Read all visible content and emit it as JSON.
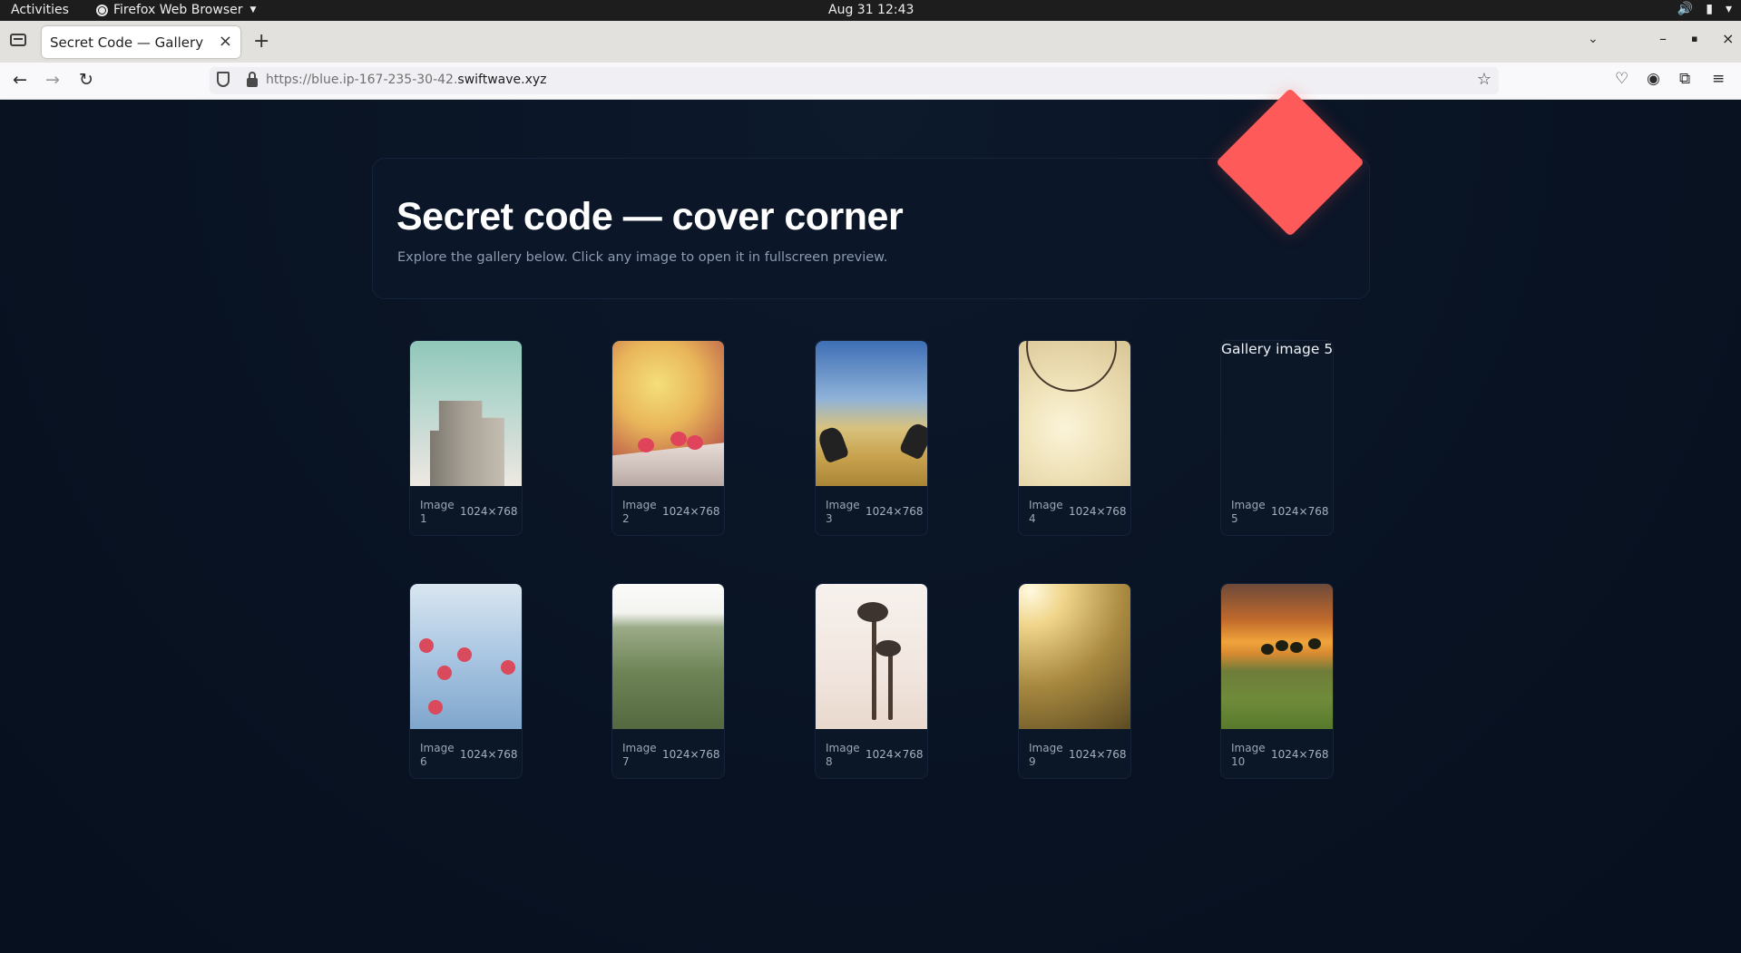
{
  "topbar": {
    "activities": "Activities",
    "app_name": "Firefox Web Browser",
    "clock": "Aug 31  12:43"
  },
  "browser": {
    "tab_title": "Secret Code — Gallery",
    "url_prefix": "https://blue.ip-167-235-30-42.",
    "url_domain": "swiftwave.xyz"
  },
  "page": {
    "title": "Secret code — cover corner",
    "subtitle": "Explore the gallery below. Click any image to open it in fullscreen preview.",
    "accent_color": "#ff5a5a"
  },
  "gallery": [
    {
      "caption": "Image 1",
      "dims": "1024×768"
    },
    {
      "caption": "Image 2",
      "dims": "1024×768"
    },
    {
      "caption": "Image 3",
      "dims": "1024×768"
    },
    {
      "caption": "Image 4",
      "dims": "1024×768"
    },
    {
      "caption": "Image 5",
      "dims": "1024×768",
      "alt": "Gallery image 5"
    },
    {
      "caption": "Image 6",
      "dims": "1024×768"
    },
    {
      "caption": "Image 7",
      "dims": "1024×768"
    },
    {
      "caption": "Image 8",
      "dims": "1024×768"
    },
    {
      "caption": "Image 9",
      "dims": "1024×768"
    },
    {
      "caption": "Image 10",
      "dims": "1024×768"
    }
  ]
}
